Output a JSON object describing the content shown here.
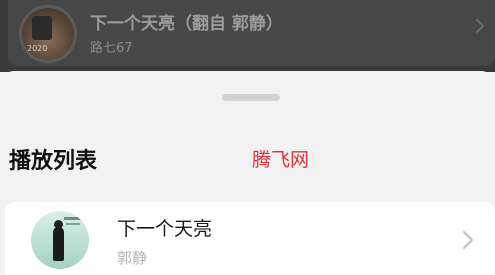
{
  "now_playing": {
    "title": "下一个天亮（翻自 郭静）",
    "artist": "路七67",
    "cover_year": "2020",
    "chevron_icon": "chevron-right-icon"
  },
  "playlist_sheet": {
    "title": "播放列表",
    "watermark": "腾飞网",
    "tracks": [
      {
        "title": "下一个天亮",
        "artist": "郭静",
        "chevron_icon": "chevron-right-icon"
      }
    ]
  },
  "colors": {
    "overlay": "#3a3a3a",
    "sheet_bg": "#f2f2f2",
    "card_bg": "#ffffff",
    "watermark": "#e0323c"
  }
}
